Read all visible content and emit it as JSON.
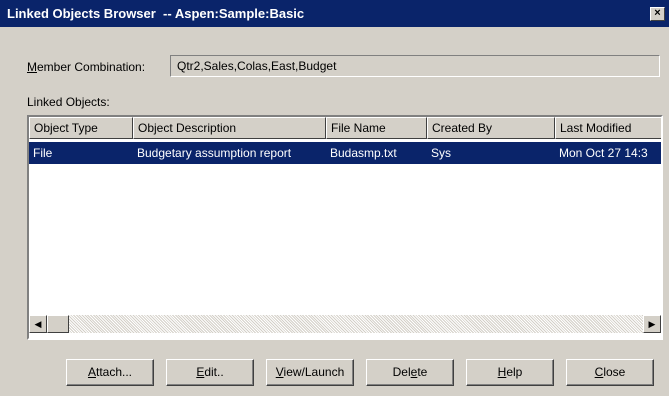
{
  "window": {
    "title": "Linked Objects Browser  -- Aspen:Sample:Basic",
    "close_glyph": "×"
  },
  "member_combination": {
    "label_underlined": "M",
    "label_rest": "ember Combination:",
    "value": "Qtr2,Sales,Colas,East,Budget"
  },
  "linked_objects": {
    "label": "Linked Objects:",
    "columns": [
      "Object Type",
      "Object Description",
      "File Name",
      "Created By",
      "Last Modified"
    ],
    "rows": [
      [
        "File",
        "Budgetary assumption report",
        "Budasmp.txt",
        "Sys",
        "Mon Oct 27 14:3"
      ]
    ]
  },
  "scroll": {
    "left_glyph": "◀",
    "right_glyph": "▶"
  },
  "buttons": {
    "attach": {
      "u": "A",
      "rest": "ttach..."
    },
    "edit": {
      "u": "E",
      "rest": "dit.."
    },
    "view": {
      "u": "V",
      "rest": "iew/Launch"
    },
    "delete": {
      "pre": "Del",
      "u": "e",
      "rest": "te"
    },
    "help": {
      "u": "H",
      "rest": "elp"
    },
    "close": {
      "u": "C",
      "rest": "lose"
    }
  }
}
